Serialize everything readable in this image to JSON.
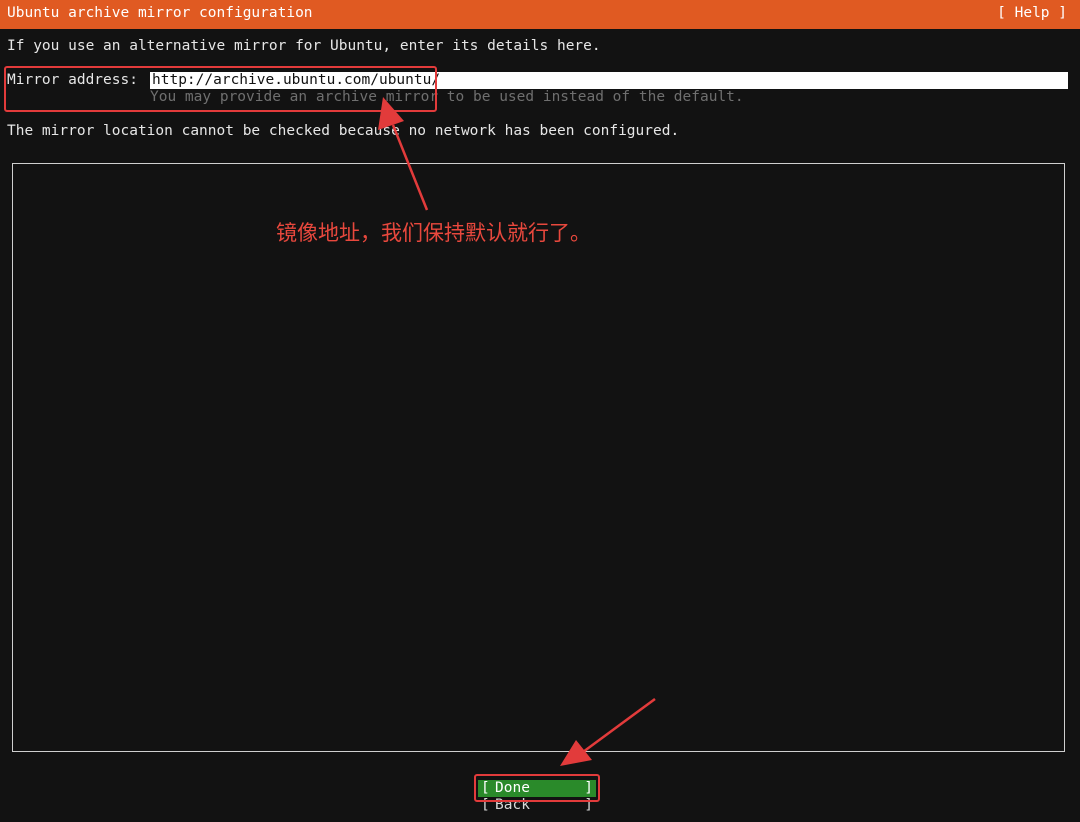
{
  "titlebar": {
    "title": "Ubuntu archive mirror configuration",
    "help_label": "[ Help ]"
  },
  "intro_text": "If you use an alternative mirror for Ubuntu, enter its details here.",
  "mirror": {
    "label": "Mirror address:",
    "value": "http://archive.ubuntu.com/ubuntu/",
    "hint": "You may provide an archive mirror to be used instead of the default."
  },
  "status_text": "The mirror location cannot be checked because no network has been configured.",
  "buttons": {
    "done_label": "Done",
    "back_label": "Back",
    "bracket_left": "[",
    "bracket_right": "]"
  },
  "annotation": {
    "note": "镜像地址，我们保持默认就行了。",
    "color": "#e23b3b"
  },
  "colors": {
    "titlebar_bg": "#e05a22",
    "done_bg": "#2a8a2a",
    "background": "#121212"
  }
}
